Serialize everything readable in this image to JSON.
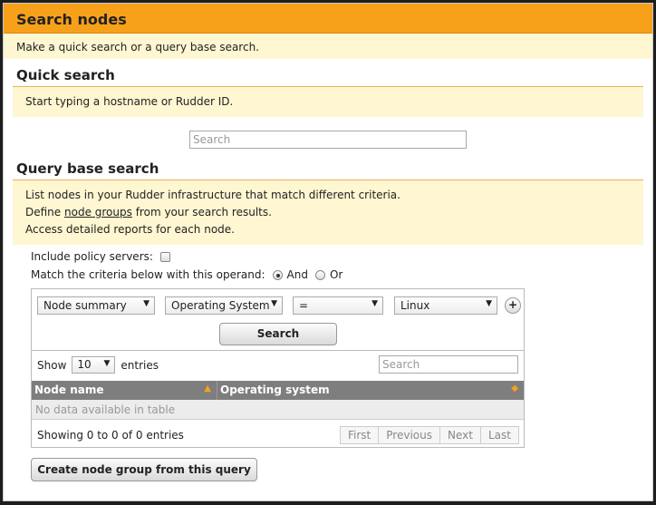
{
  "header": {
    "title": "Search nodes"
  },
  "intro": {
    "text": "Make a quick search or a query base search."
  },
  "quick": {
    "title": "Quick search",
    "note": "Start typing a hostname or Rudder ID.",
    "placeholder": "Search"
  },
  "query": {
    "title": "Query base search",
    "lines": [
      "List nodes in your Rudder infrastructure that match different criteria.",
      "from your search results.",
      "Access detailed reports for each node."
    ],
    "define_prefix": "Define",
    "define_link": "node groups",
    "include_label": "Include policy servers:",
    "operand_label": "Match the criteria below with this operand:",
    "operand_and": "And",
    "operand_or": "Or",
    "criteria": {
      "object": "Node summary",
      "attribute": "Operating System",
      "comparator": "=",
      "value": "Linux",
      "add": "+"
    },
    "search_button": "Search",
    "table": {
      "show_label": "Show",
      "entries_label": "entries",
      "page_size": "10",
      "search_placeholder": "Search",
      "columns": [
        "Node name",
        "Operating system"
      ],
      "empty": "No data available in table",
      "info": "Showing 0 to 0 of 0 entries",
      "pager": [
        "First",
        "Previous",
        "Next",
        "Last"
      ]
    },
    "create_group_button": "Create node group from this query"
  },
  "icons": {
    "dropdown": "chevron-down-icon",
    "sort_asc": "sort-ascending-icon",
    "sort_both": "sort-icon"
  },
  "colors": {
    "accent": "#f7a11b",
    "note_bg": "#fff6d2",
    "table_header": "#7e7e7e"
  }
}
